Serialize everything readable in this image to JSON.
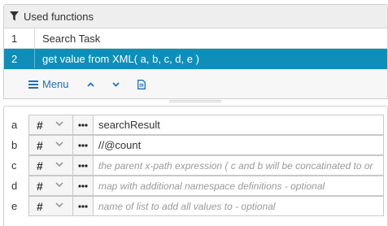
{
  "used_functions": {
    "title": "Used functions",
    "rows": [
      {
        "num": "1",
        "label": "Search Task",
        "selected": false
      },
      {
        "num": "2",
        "label": "get value from XML( a, b, c, d, e )",
        "selected": true
      }
    ],
    "toolbar": {
      "menu_label": "Menu",
      "icons": [
        "bars-icon",
        "chevron-up-icon",
        "chevron-down-icon",
        "document-icon"
      ]
    }
  },
  "parameters": [
    {
      "name": "a",
      "type": "#",
      "value": "searchResult",
      "placeholder": ""
    },
    {
      "name": "b",
      "type": "#",
      "value": "//@count",
      "placeholder": ""
    },
    {
      "name": "c",
      "type": "#",
      "value": "",
      "placeholder": "the parent x-path expression ( c and b will be concatinated to or"
    },
    {
      "name": "d",
      "type": "#",
      "value": "",
      "placeholder": "map with additional namespace definitions - optional"
    },
    {
      "name": "e",
      "type": "#",
      "value": "",
      "placeholder": "name of list to add all values to - optional"
    }
  ],
  "colors": {
    "accent": "#0f8fb8",
    "link": "#1e6fb8"
  }
}
